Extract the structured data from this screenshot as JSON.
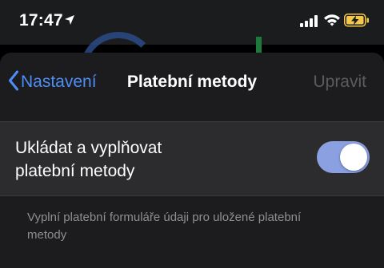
{
  "status_bar": {
    "time": "17:47",
    "icons": [
      "location-arrow-icon",
      "cellular-signal-icon",
      "wifi-icon",
      "battery-charging-icon"
    ]
  },
  "nav": {
    "back_label": "Nastavení",
    "title": "Platební metody",
    "edit_label": "Upravit"
  },
  "setting": {
    "label_line1": "Ukládat a vyplňovat",
    "label_line2": "platební metody",
    "enabled": true
  },
  "footer": {
    "note_line1": "Vyplní platební formuláře údaji pro uložené platební",
    "note_line2": "metody"
  },
  "colors": {
    "accent": "#4d8ef7",
    "toggle_on": "#8aa0e0",
    "sheet_bg": "#1c1c1e",
    "row_bg": "#2c2c2e",
    "battery_fill": "#f5c84c"
  }
}
